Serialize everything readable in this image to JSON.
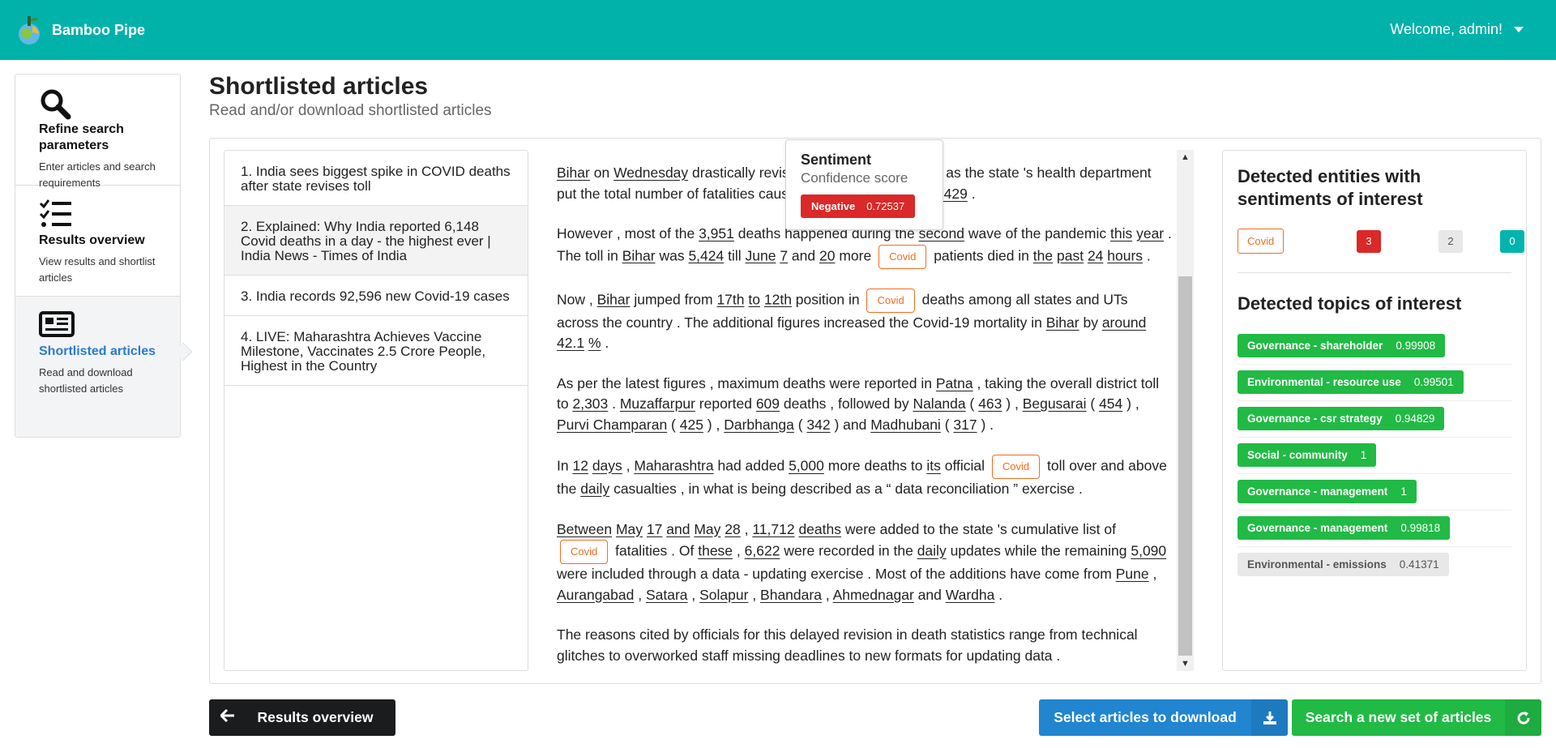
{
  "app": {
    "name": "Bamboo Pipe",
    "welcome": "Welcome, admin!"
  },
  "sidebar": {
    "items": [
      {
        "title": "Refine search parameters",
        "desc": "Enter articles and search requirements",
        "icon": "search-icon"
      },
      {
        "title": "Results overview",
        "desc": "View results and shortlist articles",
        "icon": "list-check-icon"
      },
      {
        "title": "Shortlisted articles",
        "desc": "Read and download shortlisted articles",
        "icon": "newspaper-icon"
      }
    ]
  },
  "page": {
    "title": "Shortlisted articles",
    "subtitle": "Read and/or download shortlisted articles"
  },
  "articles": [
    "1. India sees biggest spike in COVID deaths after state revises toll",
    "2. Explained: Why India reported 6,148 Covid deaths in a day - the highest ever | India News - Times of India",
    "3. India records 92,596 new Covid-19 cases",
    "4. LIVE: Maharashtra Achieves Vaccine Milestone, Vaccinates 2.5 Crore People, Highest in the Country"
  ],
  "tooltip": {
    "title": "Sentiment",
    "subtitle": "Confidence score",
    "label": "Negative",
    "score": "0.72537"
  },
  "entities": {
    "title": "Detected entities with sentiments of interest",
    "items": [
      {
        "name": "Covid",
        "negative": "3",
        "neutral": "2",
        "positive": "0"
      }
    ]
  },
  "topics": {
    "title": "Detected topics of interest",
    "items": [
      {
        "name": "Governance - shareholder",
        "score": "0.99908",
        "color": "#21ba45"
      },
      {
        "name": "Environmental - resource use",
        "score": "0.99501",
        "color": "#21ba45"
      },
      {
        "name": "Governance - csr strategy",
        "score": "0.94829",
        "color": "#21ba45"
      },
      {
        "name": "Social - community",
        "score": "1",
        "color": "#21ba45"
      },
      {
        "name": "Governance - management",
        "score": "1",
        "color": "#21ba45"
      },
      {
        "name": "Governance - management",
        "score": "0.99818",
        "color": "#21ba45"
      },
      {
        "name": "Environmental - emissions",
        "score": "0.41371",
        "color": "#e8e8e8"
      }
    ]
  },
  "buttons": {
    "back": "Results overview",
    "download": "Select articles to download",
    "search": "Search a new set of articles"
  },
  "body": {
    "p1": [
      {
        "t": "Bihar",
        "u": true
      },
      {
        "t": " on "
      },
      {
        "t": "Wednesday",
        "u": true
      },
      {
        "t": " drastically revise"
      },
      {
        "t": "d its death toll upwards as the state 's health department put the total number of fa",
        "hidden": true
      },
      {
        "t": "talities caused by the pandemic at "
      },
      {
        "t": "9,429",
        "u": true
      },
      {
        "t": " ."
      }
    ],
    "p2": [
      {
        "t": "However , most of the "
      },
      {
        "t": "3,951",
        "u": true
      },
      {
        "t": " deaths happened du"
      },
      {
        "t": "ring the "
      },
      {
        "t": "second",
        "u": true
      },
      {
        "t": " wave of the pandemic "
      },
      {
        "t": "this",
        "u": true
      },
      {
        "t": " "
      },
      {
        "t": "year",
        "u": true
      },
      {
        "t": " . The toll in "
      },
      {
        "t": "Bihar",
        "u": true
      },
      {
        "t": " was "
      },
      {
        "t": "5,424",
        "u": true
      },
      {
        "t": " till "
      },
      {
        "t": "June",
        "u": true
      },
      {
        "t": " "
      },
      {
        "t": "7",
        "u": true
      },
      {
        "t": " and "
      },
      {
        "t": "20",
        "u": true
      },
      {
        "t": " more "
      },
      {
        "tag": "Covid"
      },
      {
        "t": " patients died in "
      },
      {
        "t": "the",
        "u": true
      },
      {
        "t": " "
      },
      {
        "t": "past",
        "u": true
      },
      {
        "t": " "
      },
      {
        "t": "24",
        "u": true
      },
      {
        "t": " "
      },
      {
        "t": "hours",
        "u": true
      },
      {
        "t": " ."
      }
    ],
    "p3": [
      {
        "t": "Now , "
      },
      {
        "t": "Bihar",
        "u": true
      },
      {
        "t": " jumped from "
      },
      {
        "t": "17th",
        "u": true
      },
      {
        "t": " "
      },
      {
        "t": "to",
        "u": true
      },
      {
        "t": " "
      },
      {
        "t": "12th",
        "u": true
      },
      {
        "t": " position in "
      },
      {
        "tag": "Covid"
      },
      {
        "t": " deaths among all states and UTs across the country . The additional figures increased the Covid-19 mortality in "
      },
      {
        "t": "Bihar",
        "u": true
      },
      {
        "t": " by "
      },
      {
        "t": "around",
        "u": true
      },
      {
        "t": " "
      },
      {
        "t": "42.1",
        "u": true
      },
      {
        "t": " "
      },
      {
        "t": "%",
        "u": true
      },
      {
        "t": " ."
      }
    ],
    "p4": [
      {
        "t": "As per the latest figures , maximum deaths were reported in "
      },
      {
        "t": "Patna",
        "u": true
      },
      {
        "t": " , taking the overall district toll to "
      },
      {
        "t": "2,303",
        "u": true
      },
      {
        "t": " . "
      },
      {
        "t": "Muzaffarpur",
        "u": true
      },
      {
        "t": " reported "
      },
      {
        "t": "609",
        "u": true
      },
      {
        "t": " deaths , followed by "
      },
      {
        "t": "Nalanda",
        "u": true
      },
      {
        "t": " ( "
      },
      {
        "t": "463",
        "u": true
      },
      {
        "t": " ) , "
      },
      {
        "t": "Begusarai",
        "u": true
      },
      {
        "t": " ( "
      },
      {
        "t": "454",
        "u": true
      },
      {
        "t": " ) , "
      },
      {
        "t": "Purvi Champaran",
        "u": true
      },
      {
        "t": " ( "
      },
      {
        "t": "425",
        "u": true
      },
      {
        "t": " ) , "
      },
      {
        "t": "Darbhanga",
        "u": true
      },
      {
        "t": " ( "
      },
      {
        "t": "342",
        "u": true
      },
      {
        "t": " ) and "
      },
      {
        "t": "Madhubani",
        "u": true
      },
      {
        "t": " ( "
      },
      {
        "t": "317",
        "u": true
      },
      {
        "t": " ) ."
      }
    ],
    "p5": [
      {
        "t": "In "
      },
      {
        "t": "12",
        "u": true
      },
      {
        "t": " "
      },
      {
        "t": "days",
        "u": true
      },
      {
        "t": " , "
      },
      {
        "t": "Maharashtra",
        "u": true
      },
      {
        "t": " had added "
      },
      {
        "t": "5,000",
        "u": true
      },
      {
        "t": " more deaths to "
      },
      {
        "t": "its",
        "u": true
      },
      {
        "t": " official "
      },
      {
        "tag": "Covid"
      },
      {
        "t": " toll over and above the "
      },
      {
        "t": "daily",
        "u": true
      },
      {
        "t": " casualties , in what is being described as a “ data reconciliation ” exercise ."
      }
    ],
    "p6": [
      {
        "t": "Between",
        "u": true
      },
      {
        "t": " "
      },
      {
        "t": "May",
        "u": true
      },
      {
        "t": " "
      },
      {
        "t": "17",
        "u": true
      },
      {
        "t": " "
      },
      {
        "t": "and",
        "u": true
      },
      {
        "t": " "
      },
      {
        "t": "May",
        "u": true
      },
      {
        "t": " "
      },
      {
        "t": "28",
        "u": true
      },
      {
        "t": " , "
      },
      {
        "t": "11,712",
        "u": true
      },
      {
        "t": " "
      },
      {
        "t": "deaths",
        "u": true
      },
      {
        "t": " were added to the state 's cumulative list of "
      },
      {
        "tag": "Covid"
      },
      {
        "t": " fatalities . Of "
      },
      {
        "t": "these",
        "u": true
      },
      {
        "t": " , "
      },
      {
        "t": "6,622",
        "u": true
      },
      {
        "t": " were recorded in the "
      },
      {
        "t": "daily",
        "u": true
      },
      {
        "t": " updates while the remaining "
      },
      {
        "t": "5,090",
        "u": true
      },
      {
        "t": " were included through a data - updating exercise . Most of the additions have come from "
      },
      {
        "t": "Pune",
        "u": true
      },
      {
        "t": " , "
      },
      {
        "t": "Aurangabad",
        "u": true
      },
      {
        "t": " , "
      },
      {
        "t": "Satara",
        "u": true
      },
      {
        "t": " , "
      },
      {
        "t": "Solapur",
        "u": true
      },
      {
        "t": " , "
      },
      {
        "t": "Bhandara",
        "u": true
      },
      {
        "t": " , "
      },
      {
        "t": "Ahmednagar",
        "u": true
      },
      {
        "t": " and "
      },
      {
        "t": "Wardha",
        "u": true
      },
      {
        "t": " ."
      }
    ],
    "p7": [
      {
        "t": "The reasons cited by officials for this delayed revision in death statistics range from technical glitches to overworked staff missing deadlines to new formats for updating data ."
      }
    ]
  }
}
